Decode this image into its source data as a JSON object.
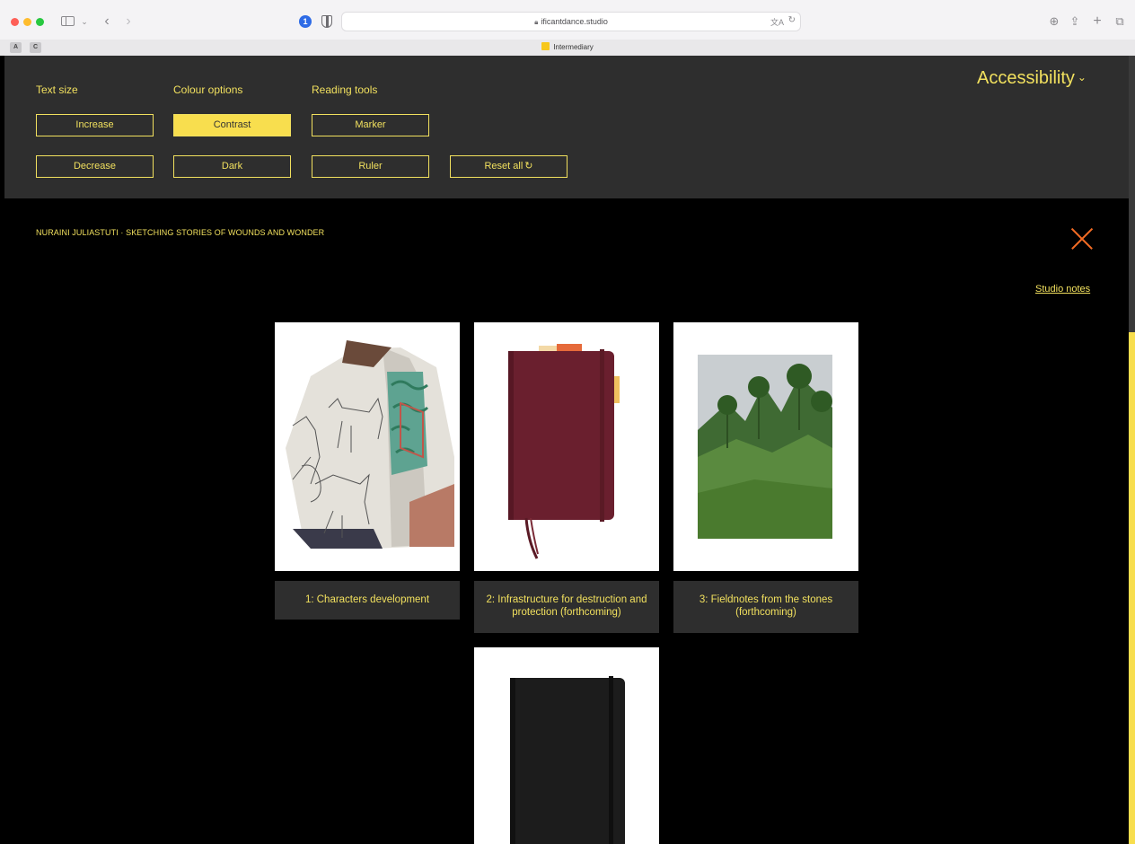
{
  "browser": {
    "url": "ificantdance.studio",
    "tab_title": "Intermediary",
    "extensions": [
      "A",
      "C"
    ],
    "onepassword_glyph": "1"
  },
  "accessibility": {
    "toggle_label": "Accessibility",
    "headings": {
      "text_size": "Text size",
      "colour_options": "Colour options",
      "reading_tools": "Reading tools"
    },
    "buttons": {
      "increase": "Increase",
      "decrease": "Decrease",
      "contrast": "Contrast",
      "dark": "Dark",
      "marker": "Marker",
      "ruler": "Ruler",
      "reset_all": "Reset all"
    },
    "active_button": "contrast"
  },
  "page": {
    "title": "NURAINI JULIASTUTI · SKETCHING STORIES OF WOUNDS AND WONDER",
    "studio_notes": "Studio notes",
    "cards": [
      {
        "caption": "1: Characters development"
      },
      {
        "caption": "2: Infrastructure for destruction and protection (forthcoming)"
      },
      {
        "caption": "3: Fieldnotes from the stones (forthcoming)"
      },
      {
        "caption": ""
      }
    ]
  },
  "colors": {
    "accent_yellow": "#f1e05e",
    "button_active": "#f8de4e",
    "panel_bg": "#2e2e2e",
    "close_orange": "#f26b24"
  }
}
